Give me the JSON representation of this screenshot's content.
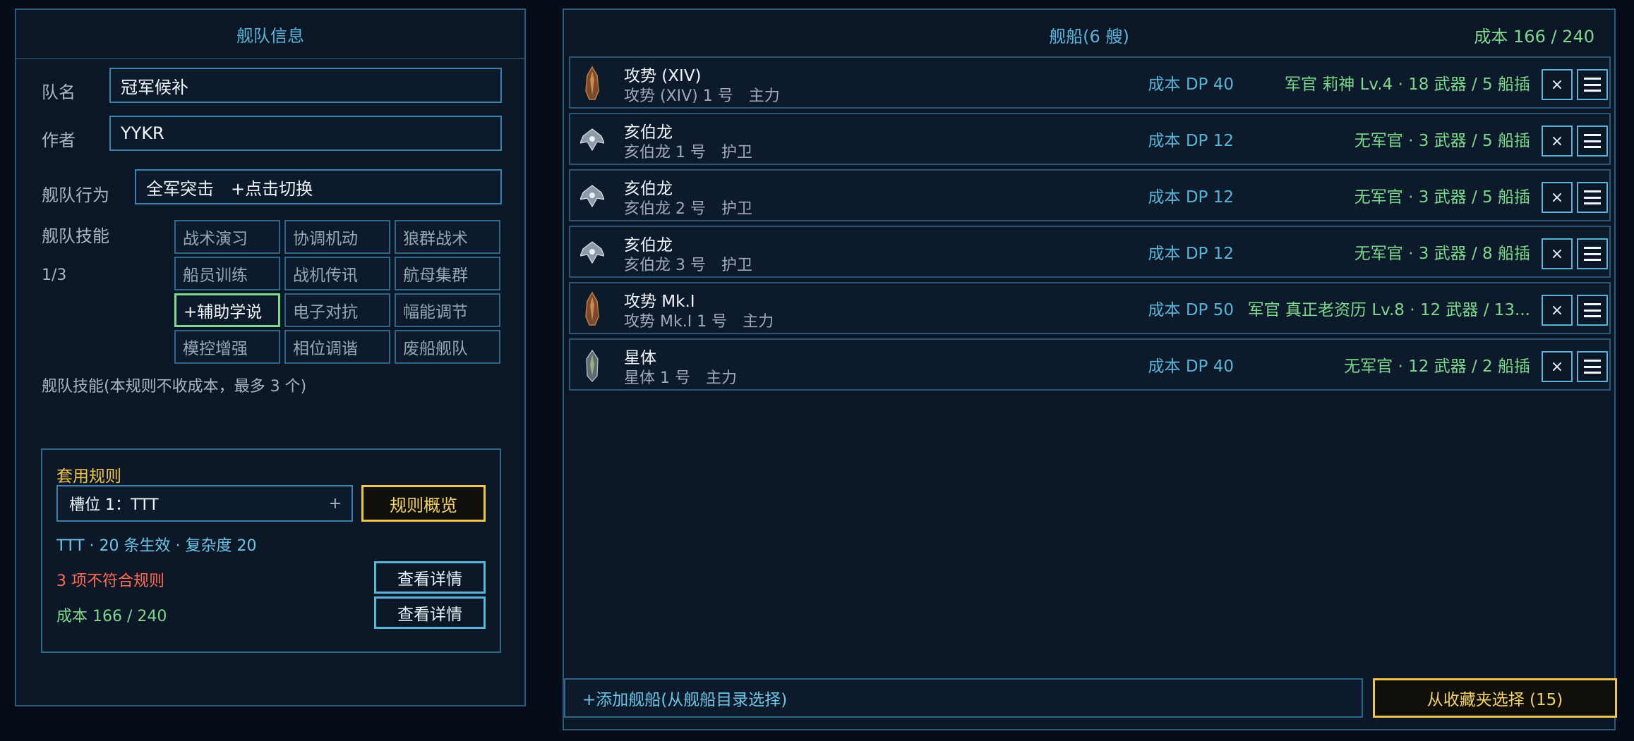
{
  "fleet_info": {
    "title": "舰队信息",
    "name_label": "队名",
    "name_value": "冠军候补",
    "author_label": "作者",
    "author_value": "YYKR",
    "behavior_label": "舰队行为",
    "behavior_value": "全军突击　+点击切换",
    "skills_label": "舰队技能",
    "skills_count": "1/3",
    "skills": [
      "战术演习",
      "协调机动",
      "狼群战术",
      "船员训练",
      "战机传讯",
      "航母集群",
      "+辅助学说",
      "电子对抗",
      "幅能调节",
      "模控增强",
      "相位调谐",
      "废船舰队"
    ],
    "skills_note": "舰队技能(本规则不收成本，最多 3 个)"
  },
  "rules": {
    "title": "套用规则",
    "slot_value": "槽位 1：TTT",
    "slot_plus": "+",
    "overview_button": "规则概览",
    "summary": "TTT · 20 条生效 · 复杂度 20",
    "violation": "3 项不符合规则",
    "cost": "成本 166 / 240",
    "detail_button_1": "查看详情",
    "detail_button_2": "查看详情"
  },
  "ships_panel": {
    "title": "舰船(6 艘)",
    "cost": "成本 166 / 240",
    "remove_glyph": "×",
    "ships": [
      {
        "name": "攻势 (XIV)",
        "sub": "攻势 (XIV) 1 号　主力",
        "cost": "成本 DP 40",
        "officer": "军官 莉神 Lv.4 · 18 武器 / 5 船插",
        "icon": "ship-icon-brown"
      },
      {
        "name": "亥伯龙",
        "sub": "亥伯龙 1 号　护卫",
        "cost": "成本 DP 12",
        "officer": "无军官 · 3 武器 / 5 船插",
        "icon": "ship-icon-silver"
      },
      {
        "name": "亥伯龙",
        "sub": "亥伯龙 2 号　护卫",
        "cost": "成本 DP 12",
        "officer": "无军官 · 3 武器 / 5 船插",
        "icon": "ship-icon-silver"
      },
      {
        "name": "亥伯龙",
        "sub": "亥伯龙 3 号　护卫",
        "cost": "成本 DP 12",
        "officer": "无军官 · 3 武器 / 8 船插",
        "icon": "ship-icon-silver"
      },
      {
        "name": "攻势 Mk.I",
        "sub": "攻势 Mk.I 1 号　主力",
        "cost": "成本 DP 50",
        "officer": "军官 真正老资历 Lv.8 · 12 武器 / 13...",
        "icon": "ship-icon-brown"
      },
      {
        "name": "星体",
        "sub": "星体 1 号　主力",
        "cost": "成本 DP 40",
        "officer": "无军官 · 12 武器 / 2 船插",
        "icon": "ship-icon-grey"
      }
    ],
    "add_ship": "+添加舰船(从舰船目录选择)",
    "from_favorites": "从收藏夹选择 (15)"
  },
  "colors": {
    "background": "#070d18",
    "panel_border": "#2d5a78",
    "accent_blue": "#5ab4d8",
    "accent_green": "#7dd88b",
    "accent_yellow": "#f0c54d",
    "error_red": "#ff6a55"
  }
}
